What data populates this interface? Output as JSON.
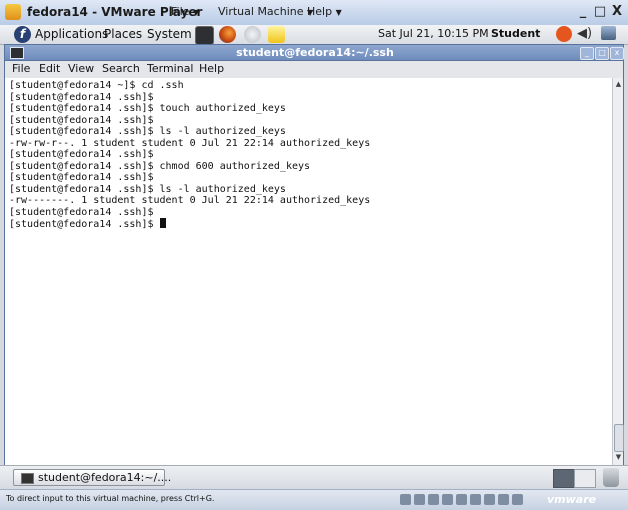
{
  "vm_window": {
    "title": "fedora14 - VMware Player",
    "menus": [
      {
        "label": "File"
      },
      {
        "label": "Virtual Machine"
      },
      {
        "label": "Help"
      }
    ],
    "controls": {
      "minimize": "_",
      "maximize": "□",
      "close": "X"
    }
  },
  "top_panel": {
    "menus": [
      "Applications",
      "Places",
      "System"
    ],
    "launchers": [
      "terminal-icon",
      "firefox-icon",
      "email-icon",
      "notes-icon"
    ],
    "clock": "Sat Jul 21, 10:15 PM",
    "user": "Student",
    "tray_icons": [
      "update-icon",
      "volume-icon",
      "network-icon"
    ]
  },
  "terminal": {
    "title": "student@fedora14:~/.ssh",
    "menus": [
      "File",
      "Edit",
      "View",
      "Search",
      "Terminal",
      "Help"
    ],
    "output": "[student@fedora14 ~]$ cd .ssh\n[student@fedora14 .ssh]$\n[student@fedora14 .ssh]$ touch authorized_keys\n[student@fedora14 .ssh]$\n[student@fedora14 .ssh]$ ls -l authorized_keys\n-rw-rw-r--. 1 student student 0 Jul 21 22:14 authorized_keys\n[student@fedora14 .ssh]$\n[student@fedora14 .ssh]$ chmod 600 authorized_keys\n[student@fedora14 .ssh]$\n[student@fedora14 .ssh]$ ls -l authorized_keys\n-rw-------. 1 student student 0 Jul 21 22:14 authorized_keys\n[student@fedora14 .ssh]$\n[student@fedora14 .ssh]$ "
  },
  "bottom_panel": {
    "task_label": "student@fedora14:~/...."
  },
  "vm_status": {
    "hint": "To direct input to this virtual machine, press Ctrl+G.",
    "brand": "vmware"
  },
  "colors": {
    "terminal_background": "#ffffff",
    "terminal_title_bar": "#7d98c5",
    "vmware_status_bar": "#c6d1e1"
  }
}
